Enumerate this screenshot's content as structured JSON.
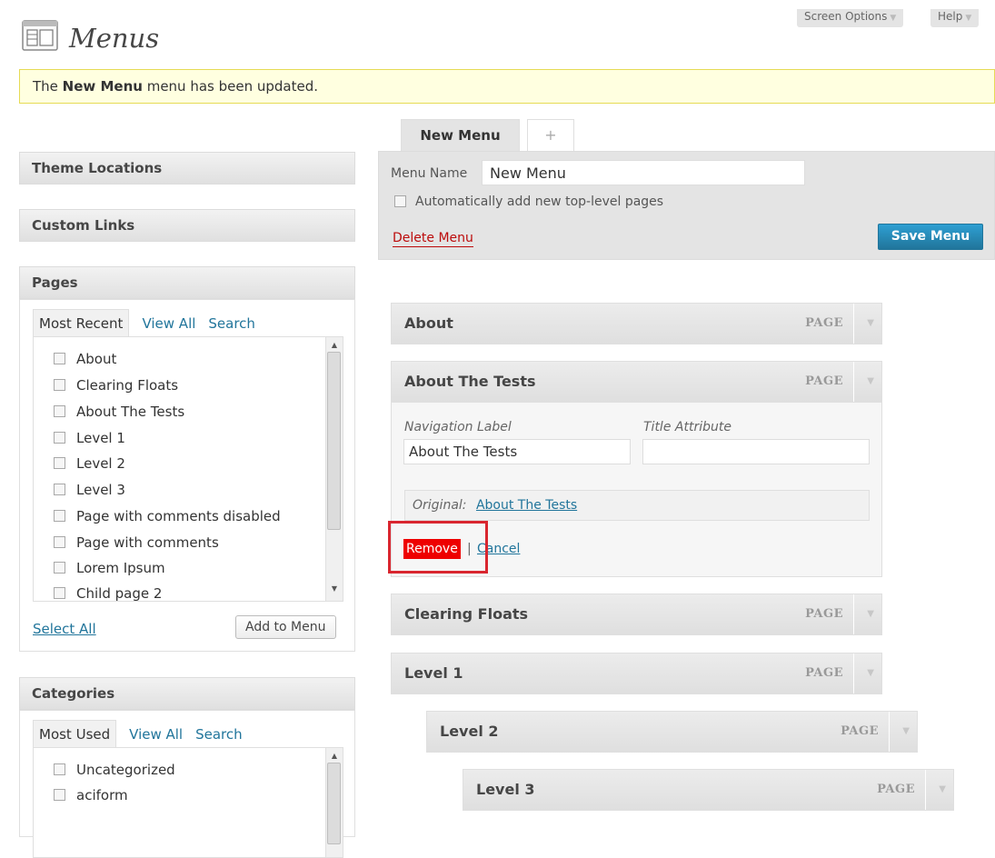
{
  "header": {
    "title": "Menus",
    "screen_options": "Screen Options",
    "help": "Help"
  },
  "notice": {
    "prefix": "The ",
    "menu_name": "New Menu",
    "suffix": " menu has been updated."
  },
  "sidebar": {
    "theme_locations": "Theme Locations",
    "custom_links": "Custom Links",
    "pages": {
      "title": "Pages",
      "tabs": [
        "Most Recent",
        "View All",
        "Search"
      ],
      "items": [
        "About",
        "Clearing Floats",
        "About The Tests",
        "Level 1",
        "Level 2",
        "Level 3",
        "Page with comments disabled",
        "Page with comments",
        "Lorem Ipsum",
        "Child page 2"
      ],
      "select_all": "Select All",
      "add_to_menu": "Add to Menu"
    },
    "categories": {
      "title": "Categories",
      "tabs": [
        "Most Used",
        "View All",
        "Search"
      ],
      "items": [
        "Uncategorized",
        "aciform"
      ]
    }
  },
  "editor": {
    "tabs": {
      "active": "New Menu",
      "add": "+"
    },
    "menu_name_label": "Menu Name",
    "menu_name_value": "New Menu",
    "auto_add_label": "Automatically add new top-level pages",
    "delete_menu": "Delete Menu",
    "save_menu": "Save Menu"
  },
  "menu_items": [
    {
      "title": "About",
      "type": "PAGE"
    },
    {
      "title": "About The Tests",
      "type": "PAGE"
    },
    {
      "title": "Clearing Floats",
      "type": "PAGE"
    },
    {
      "title": "Level 1",
      "type": "PAGE"
    },
    {
      "title": "Level 2",
      "type": "PAGE"
    },
    {
      "title": "Level 3",
      "type": "PAGE"
    }
  ],
  "item_settings": {
    "nav_label_label": "Navigation Label",
    "nav_label_value": "About The Tests",
    "title_attr_label": "Title Attribute",
    "title_attr_value": "",
    "original_label": "Original:",
    "original_link": "About The Tests",
    "remove": "Remove",
    "separator": "|",
    "cancel": "Cancel"
  },
  "colors": {
    "link": "#21759b",
    "primary_button": "#21759b",
    "remove_button": "#ee0000",
    "highlight": "#d9262f",
    "notice_bg": "#ffffe0"
  }
}
